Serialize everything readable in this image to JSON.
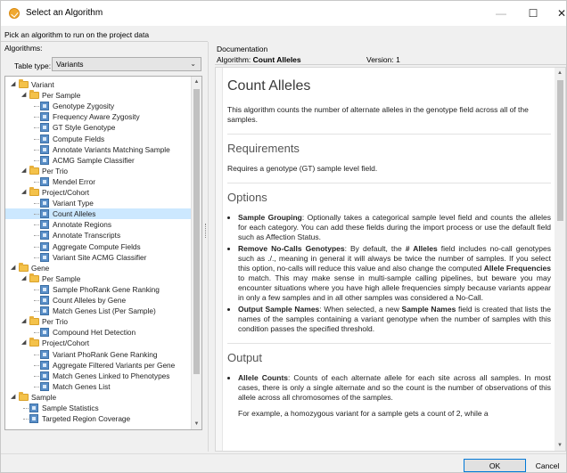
{
  "window": {
    "title": "Select an Algorithm",
    "minimize": "—",
    "maximize": "☐",
    "close": "✕",
    "accent_color": "#0078d7"
  },
  "instruction": "Pick an algorithm to run on the project data",
  "left": {
    "label": "Algorithms:",
    "table_type_label": "Table type:",
    "table_type_value": "Variants"
  },
  "tree": [
    {
      "label": "Variant",
      "type": "folder",
      "expanded": true
    },
    {
      "label": "Per Sample",
      "type": "folder",
      "expanded": true
    },
    {
      "label": "Genotype Zygosity",
      "type": "algorithm"
    },
    {
      "label": "Frequency Aware Zygosity",
      "type": "algorithm"
    },
    {
      "label": "GT Style Genotype",
      "type": "algorithm"
    },
    {
      "label": "Compute Fields",
      "type": "algorithm"
    },
    {
      "label": "Annotate Variants Matching Sample",
      "type": "algorithm"
    },
    {
      "label": "ACMG Sample Classifier",
      "type": "algorithm"
    },
    {
      "label": "Per Trio",
      "type": "folder",
      "expanded": true
    },
    {
      "label": "Mendel Error",
      "type": "algorithm"
    },
    {
      "label": "Project/Cohort",
      "type": "folder",
      "expanded": true
    },
    {
      "label": "Variant Type",
      "type": "algorithm"
    },
    {
      "label": "Count Alleles",
      "type": "algorithm",
      "selected": true
    },
    {
      "label": "Annotate Regions",
      "type": "algorithm"
    },
    {
      "label": "Annotate Transcripts",
      "type": "algorithm"
    },
    {
      "label": "Aggregate Compute Fields",
      "type": "algorithm"
    },
    {
      "label": "Variant Site ACMG Classifier",
      "type": "algorithm"
    },
    {
      "label": "Gene",
      "type": "folder",
      "expanded": true
    },
    {
      "label": "Per Sample",
      "type": "folder",
      "expanded": true
    },
    {
      "label": "Sample PhoRank Gene Ranking",
      "type": "algorithm"
    },
    {
      "label": "Count Alleles by Gene",
      "type": "algorithm"
    },
    {
      "label": "Match Genes List (Per Sample)",
      "type": "algorithm"
    },
    {
      "label": "Per Trio",
      "type": "folder",
      "expanded": true
    },
    {
      "label": "Compound Het Detection",
      "type": "algorithm"
    },
    {
      "label": "Project/Cohort",
      "type": "folder",
      "expanded": true
    },
    {
      "label": "Variant PhoRank Gene Ranking",
      "type": "algorithm"
    },
    {
      "label": "Aggregate Filtered Variants per Gene",
      "type": "algorithm"
    },
    {
      "label": "Match Genes Linked to Phenotypes",
      "type": "algorithm"
    },
    {
      "label": "Match Genes List",
      "type": "algorithm"
    },
    {
      "label": "Sample",
      "type": "folder",
      "expanded": true
    },
    {
      "label": "Sample Statistics",
      "type": "algorithm"
    },
    {
      "label": "Targeted Region Coverage",
      "type": "algorithm"
    }
  ],
  "right": {
    "label": "Documentation",
    "algorithm_prefix": "Algorithm:",
    "algorithm_name": "Count Alleles",
    "version": "Version: 1"
  },
  "doc": {
    "title": "Count Alleles",
    "intro": "This algorithm counts the number of alternate alleles in the genotype field across all of the samples.",
    "requirements_heading": "Requirements",
    "requirements_text": "Requires a genotype (GT) sample level field.",
    "options_heading": "Options",
    "opt1_title": "Sample Grouping",
    "opt1_text": ": Optionally takes a categorical sample level field and counts the alleles for each category. You can add these fields during the import process or use the default field such as Affection Status.",
    "opt2_title": "Remove No-Calls Genotypes",
    "opt2_text_a": ": By default, the ",
    "opt2_bold_a": "# Alleles",
    "opt2_text_b": " field includes no-call genotypes such as ./., meaning in general it will always be twice the number of samples. If you select this option, no-calls will reduce this value and also change the computed ",
    "opt2_bold_b": "Allele Frequencies",
    "opt2_text_c": " to match. This may make sense in multi-sample calling pipelines, but beware you may encounter situations where you have high allele frequencies simply because variants appear in only a few samples and in all other samples was considered a No-Call.",
    "opt3_title": "Output Sample Names",
    "opt3_text_a": ": When selected, a new ",
    "opt3_bold": "Sample Names",
    "opt3_text_b": " field is created that lists the names of the samples containing a variant genotype when the number of samples with this condition passes the specified threshold.",
    "output_heading": "Output",
    "out1_title": "Allele Counts",
    "out1_text": ": Counts of each alternate allele for each site across all samples. In most cases, there is only a single alternate and so the count is the number of observations of this allele across all chromosomes of the samples.",
    "out_continued": "For example, a homozygous variant for a sample gets a count of 2, while a"
  },
  "buttons": {
    "ok": "OK",
    "cancel": "Cancel"
  }
}
